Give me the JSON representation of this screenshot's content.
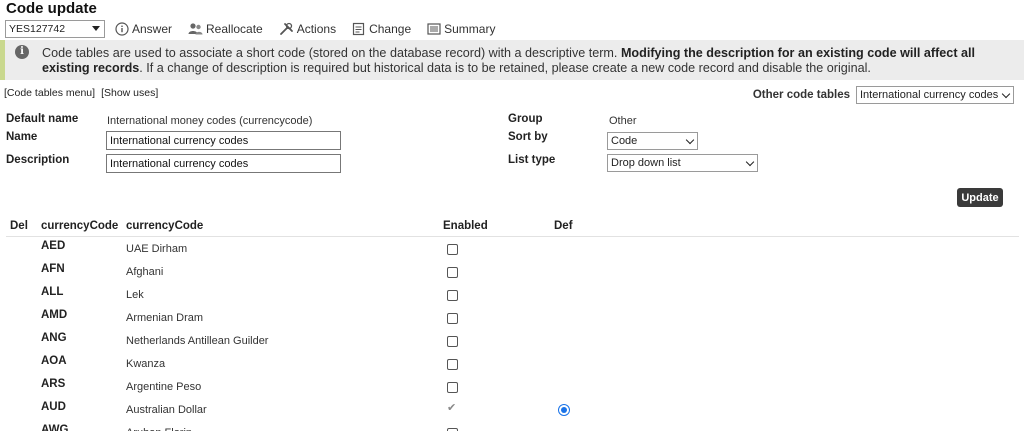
{
  "page": {
    "title": "Code update"
  },
  "toolbar": {
    "ref_value": "YES127742",
    "answer": "Answer",
    "reallocate": "Reallocate",
    "actions": "Actions",
    "change": "Change",
    "summary": "Summary"
  },
  "info": {
    "text_1": "Code tables are used to associate a short code (stored on the database record) with a descriptive term. ",
    "text_bold": "Modifying the description for an existing code will affect all existing records",
    "text_2": ". If a change of description is required but historical data is to be retained, please create a new code record and disable the original."
  },
  "links": {
    "menu": "[Code tables menu]",
    "uses": "[Show uses]"
  },
  "other_tables": {
    "label": "Other code tables",
    "value": "International currency codes"
  },
  "form": {
    "default_name_label": "Default name",
    "default_name_value": "International money codes (currencycode)",
    "name_label": "Name",
    "name_value": "International currency codes",
    "description_label": "Description",
    "description_value": "International currency codes",
    "group_label": "Group",
    "group_value": "Other",
    "sort_label": "Sort by",
    "sort_value": "Code",
    "list_type_label": "List type",
    "list_type_value": "Drop down list",
    "update_label": "Update"
  },
  "table": {
    "headers": {
      "del": "Del",
      "code": "currencyCode",
      "desc": "currencyCode",
      "enabled": "Enabled",
      "def": "Def"
    },
    "rows": [
      {
        "code": "AED",
        "desc": "UAE Dirham",
        "enabled": "box",
        "default": false
      },
      {
        "code": "AFN",
        "desc": "Afghani",
        "enabled": "box",
        "default": false
      },
      {
        "code": "ALL",
        "desc": "Lek",
        "enabled": "box",
        "default": false
      },
      {
        "code": "AMD",
        "desc": "Armenian Dram",
        "enabled": "box",
        "default": false
      },
      {
        "code": "ANG",
        "desc": "Netherlands Antillean Guilder",
        "enabled": "box",
        "default": false
      },
      {
        "code": "AOA",
        "desc": "Kwanza",
        "enabled": "box",
        "default": false
      },
      {
        "code": "ARS",
        "desc": "Argentine Peso",
        "enabled": "box",
        "default": false
      },
      {
        "code": "AUD",
        "desc": "Australian Dollar",
        "enabled": "tick",
        "default": true
      },
      {
        "code": "AWG",
        "desc": "Aruban Florin",
        "enabled": "box",
        "default": false
      }
    ]
  },
  "colors": {
    "banner_accent": "#c9d88e",
    "radio": "#1a73e8",
    "update_button": "#3a3a3a"
  }
}
